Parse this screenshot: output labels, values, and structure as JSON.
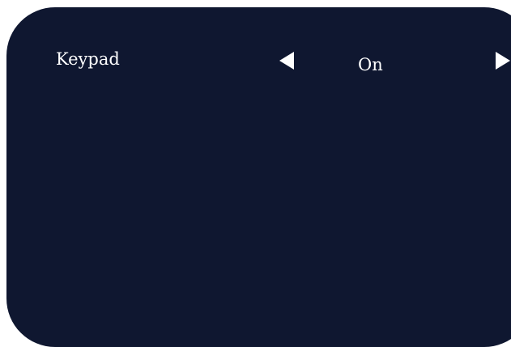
{
  "setting": {
    "label": "Keypad",
    "value": "On"
  },
  "icons": {
    "previous": "chevron-left-icon",
    "next": "chevron-right-icon"
  },
  "colors": {
    "panel": "#0f1730",
    "text": "#ffffff"
  }
}
